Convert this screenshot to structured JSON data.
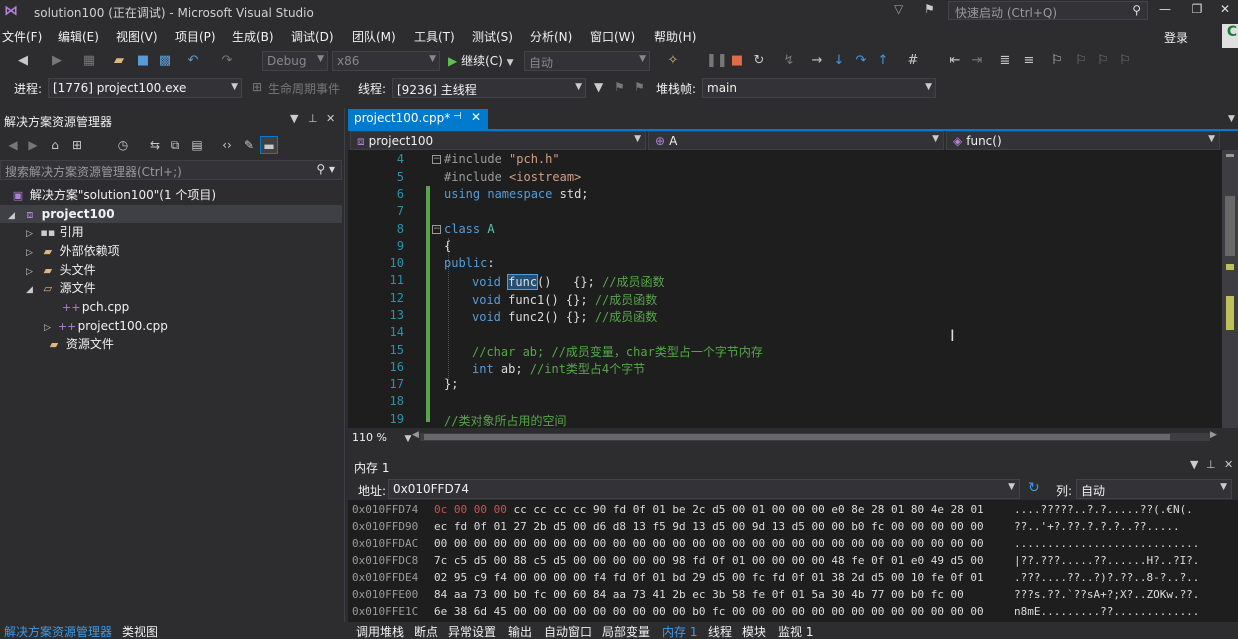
{
  "window": {
    "title": "solution100 (正在调试) - Microsoft Visual Studio",
    "quick_launch": "快速启动 (Ctrl+Q)",
    "login": "登录"
  },
  "menu": [
    "文件(F)",
    "编辑(E)",
    "视图(V)",
    "项目(P)",
    "生成(B)",
    "调试(D)",
    "团队(M)",
    "工具(T)",
    "测试(S)",
    "分析(N)",
    "窗口(W)",
    "帮助(H)"
  ],
  "toolbar": {
    "config": "Debug",
    "platform": "x86",
    "continue_label": "继续(C)",
    "auto_combo": "自动"
  },
  "debug_bar": {
    "process_label": "进程:",
    "process_value": "[1776] project100.exe",
    "lifecycle_label": "生命周期事件",
    "thread_label": "线程:",
    "thread_value": "[9236] 主线程",
    "stackframe_label": "堆栈帧:",
    "stackframe_value": "main"
  },
  "solution_explorer": {
    "title": "解决方案资源管理器",
    "search_placeholder": "搜索解决方案资源管理器(Ctrl+;)",
    "tree": [
      {
        "label": "解决方案\"solution100\"(1 个项目)",
        "icon": "solution-icon"
      },
      {
        "label": "project100",
        "icon": "project-icon"
      },
      {
        "label": "引用",
        "icon": "references-icon"
      },
      {
        "label": "外部依赖项",
        "icon": "folder-icon"
      },
      {
        "label": "头文件",
        "icon": "folder-icon"
      },
      {
        "label": "源文件",
        "icon": "folder-open-icon"
      },
      {
        "label": "pch.cpp",
        "icon": "cpp-file-icon"
      },
      {
        "label": "project100.cpp",
        "icon": "cpp-file-icon"
      },
      {
        "label": "资源文件",
        "icon": "folder-icon"
      }
    ]
  },
  "editor": {
    "tab_label": "project100.cpp*",
    "nav_project": "project100",
    "nav_class": "A",
    "nav_member": "func()",
    "zoom": "110 %",
    "line_numbers": [
      "4",
      "5",
      "6",
      "7",
      "8",
      "9",
      "10",
      "11",
      "12",
      "13",
      "14",
      "15",
      "16",
      "17",
      "18",
      "19"
    ],
    "code": {
      "l4_pp": "#include ",
      "l4_str": "\"pch.h\"",
      "l5_pp": "#include ",
      "l5_str": "<iostream>",
      "l6_kw1": "using",
      "l6_kw2": "namespace",
      "l6_rest": " std;",
      "l8_kw": "class",
      "l8_ty": " A",
      "l9": "{",
      "l10_kw": "public",
      "l10_rest": ":",
      "l11_kw": "void",
      "l11_fn": "func",
      "l11_rest": "()   {}; ",
      "l11_cm": "//成员函数",
      "l12_kw": "void",
      "l12_rest": " func1() {}; ",
      "l12_cm": "//成员函数",
      "l13_kw": "void",
      "l13_rest": " func2() {}; ",
      "l13_cm": "//成员函数",
      "l15_cm": "//char ab; //成员变量，char类型占一个字节内存",
      "l16_kw": "int",
      "l16_rest": " ab; ",
      "l16_cm": "//int类型占4个字节",
      "l17": "};",
      "l19_cm": "//类对象所占用的空间"
    }
  },
  "memory": {
    "title": "内存 1",
    "address_label": "地址:",
    "address_value": "0x010FFD74",
    "column_label": "列:",
    "column_value": "自动",
    "rows": [
      {
        "addr": "0x010FFD74",
        "changed": "0c 00 00 00",
        "bytes": " cc cc cc cc 90 fd 0f 01 be 2c d5 00 01 00 00 00 e0 8e 28 01 80 4e 28 01",
        "ascii": "....?????..?.?.....??(.€N(."
      },
      {
        "addr": "0x010FFD90",
        "changed": "",
        "bytes": "ec fd 0f 01 27 2b d5 00 d6 d8 13 f5 9d 13 d5 00 9d 13 d5 00 00 b0 fc 00 00 00 00 00",
        "ascii": "??..'+?.??.?.?.?..??....."
      },
      {
        "addr": "0x010FFDAC",
        "changed": "",
        "bytes": "00 00 00 00 00 00 00 00 00 00 00 00 00 00 00 00 00 00 00 00 00 00 00 00 00 00 00 00",
        "ascii": "............................"
      },
      {
        "addr": "0x010FFDC8",
        "changed": "",
        "bytes": "7c c5 d5 00 88 c5 d5 00 00 00 00 00 98 fd 0f 01 00 00 00 00 48 fe 0f 01 e0 49 d5 00",
        "ascii": "|??.???.....??......H?..?I?."
      },
      {
        "addr": "0x010FFDE4",
        "changed": "",
        "bytes": "02 95 c9 f4 00 00 00 00 f4 fd 0f 01 bd 29 d5 00 fc fd 0f 01 38 2d d5 00 10 fe 0f 01",
        "ascii": ".???....??..?)?.??..8-?..?.."
      },
      {
        "addr": "0x010FFE00",
        "changed": "",
        "bytes": "84 aa 73 00 b0 fc 00 60 84 aa 73 41 2b ec 3b 58 fe 0f 01 5a 30 4b 77 00 b0 fc 00",
        "ascii": "???s.??.`??sA+?;X?..ZOKw.??."
      },
      {
        "addr": "0x010FFE1C",
        "changed": "",
        "bytes": "6e 38 6d 45 00 00 00 00 00 00 00 00 00 b0 fc 00 00 00 00 00 00 00 00 00 00 00 00 00",
        "ascii": "n8mE.........??............."
      }
    ]
  },
  "bottom_tabs_left": [
    "解决方案资源管理器",
    "类视图"
  ],
  "bottom_tabs_right": [
    "调用堆栈",
    "断点",
    "异常设置",
    "输出",
    "自动窗口",
    "局部变量",
    "内存 1",
    "线程",
    "模块",
    "监视 1"
  ]
}
